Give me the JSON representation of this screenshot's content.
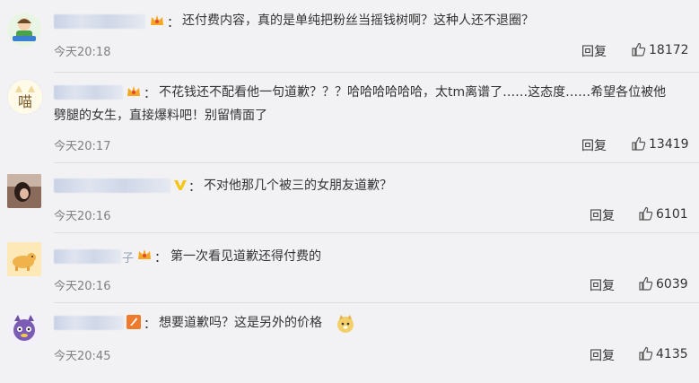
{
  "comments": [
    {
      "text": [
        "还付费内容，真的是单纯把粉丝当摇钱树啊？这种人还不退圈？"
      ],
      "time": "今天20:18",
      "reply_label": "回复",
      "likes": "18172",
      "avatar_icon": "doll-avatar-icon",
      "badge_icon": "crown-icon"
    },
    {
      "text": [
        "不花钱还不配看他一句道歉？？？哈哈哈哈哈哈，太tm离谱了……这态度……希望各位被他",
        "劈腿的女生，直接爆料吧！别留情面了"
      ],
      "time": "今天20:17",
      "reply_label": "回复",
      "likes": "13419",
      "avatar_icon": "meow-avatar-icon",
      "avatar_text": "喵",
      "badge_icon": "crown-icon"
    },
    {
      "text": [
        "不对他那几个被三的女朋友道歉？"
      ],
      "time": "今天20:16",
      "reply_label": "回复",
      "likes": "6101",
      "avatar_icon": "photo-avatar-icon",
      "badge_icon": "v-verified-icon"
    },
    {
      "text": [
        "第一次看见道歉还得付费的"
      ],
      "time": "今天20:16",
      "reply_label": "回复",
      "likes": "6039",
      "avatar_icon": "dog-avatar-icon",
      "name_tail": "子",
      "badge_icon": "crown-icon"
    },
    {
      "text": [
        "想要道歉吗？这是另外的价格"
      ],
      "time": "今天20:45",
      "reply_label": "回复",
      "likes": "4135",
      "avatar_icon": "cartoon-avatar-icon",
      "badge_icon": "orange-badge-icon",
      "emoji_icon": "doge-emoji-icon"
    }
  ],
  "colors": {
    "crown": "#f5a623",
    "vip_v": "#f5c518",
    "text": "#333333",
    "time": "#808080"
  }
}
